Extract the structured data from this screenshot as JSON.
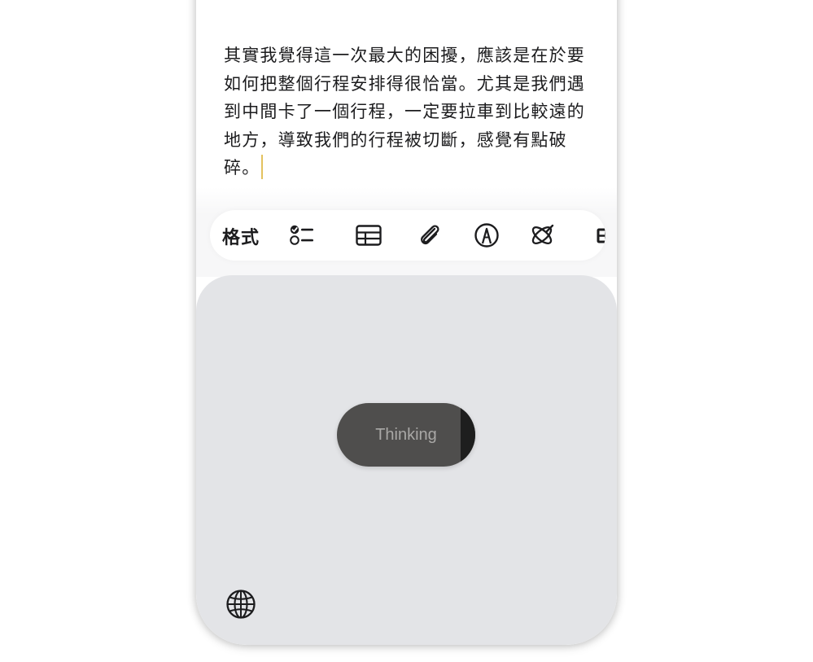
{
  "note": {
    "body": "其實我覺得這一次最大的困擾，應該是在於要如何把整個行程安排得很恰當。尤其是我們遇到中間卡了一個行程，一定要拉車到比較遠的地方，導致我們的行程被切斷，感覺有點破碎。",
    "caret_color": "#e3c25f"
  },
  "toolbar": {
    "format_label": "格式",
    "icons": [
      "checklist-icon",
      "table-icon",
      "paperclip-icon",
      "markup-pen-icon",
      "writing-tools-icon",
      "more-icon"
    ],
    "overflow_glyph": "E"
  },
  "keyboard": {
    "status_label": "Thinking",
    "background": "#e3e4e7",
    "pill_color": "#4f4e4d",
    "globe_icon": "globe-icon"
  }
}
